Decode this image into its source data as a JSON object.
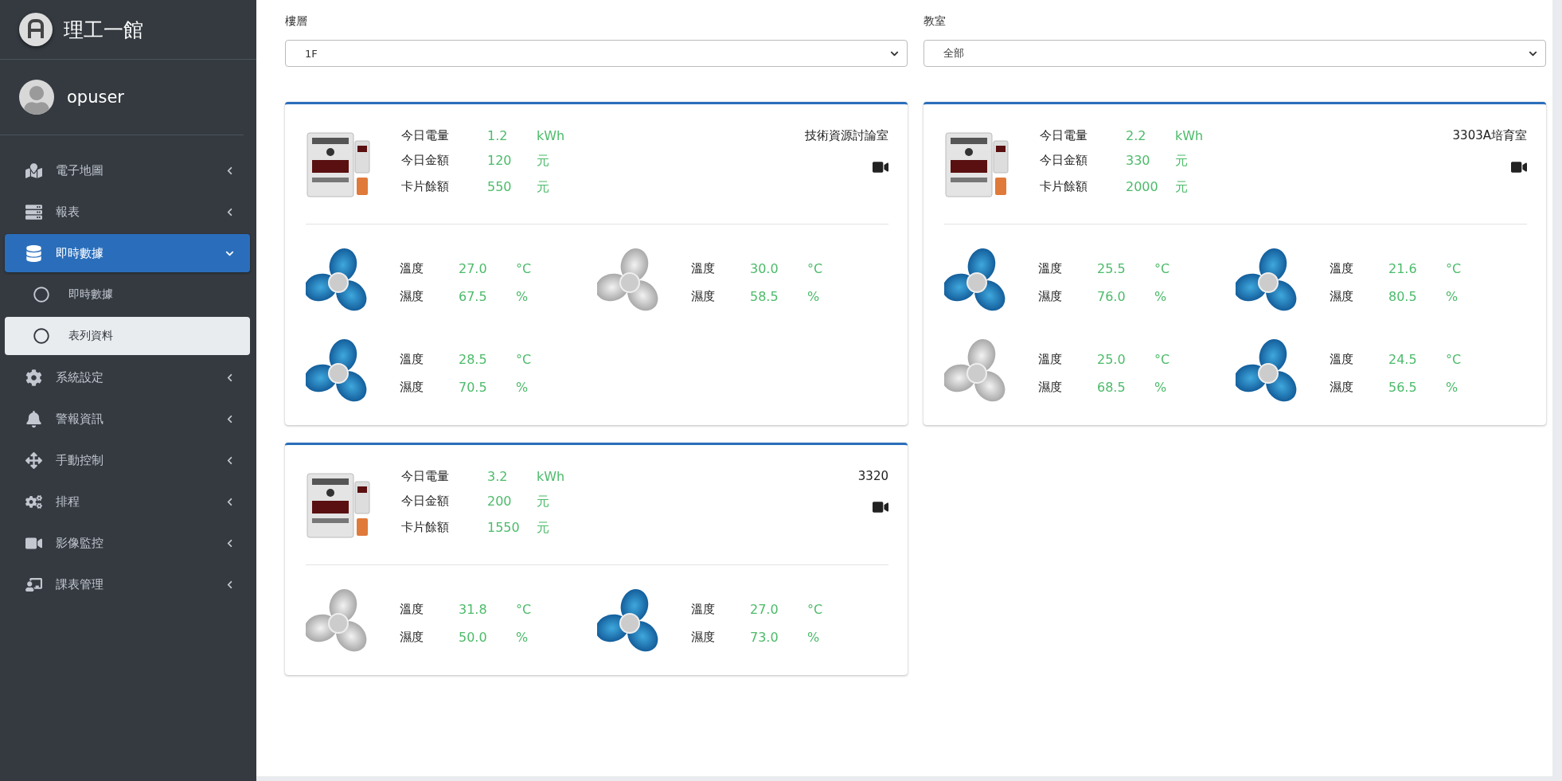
{
  "sidebar": {
    "brand": "理工一館",
    "user": "opuser",
    "menu": [
      {
        "label": "電子地圖",
        "selected": false,
        "expanded": false
      },
      {
        "label": "報表",
        "selected": false,
        "expanded": false
      },
      {
        "label": "即時數據",
        "selected": true,
        "expanded": true,
        "children": [
          {
            "label": "即時數據",
            "selected": false
          },
          {
            "label": "表列資料",
            "selected": true
          }
        ]
      },
      {
        "label": "系統設定",
        "selected": false,
        "expanded": false
      },
      {
        "label": "警報資訊",
        "selected": false,
        "expanded": false
      },
      {
        "label": "手動控制",
        "selected": false,
        "expanded": false
      },
      {
        "label": "排程",
        "selected": false,
        "expanded": false
      },
      {
        "label": "影像監控",
        "selected": false,
        "expanded": false
      },
      {
        "label": "課表管理",
        "selected": false,
        "expanded": false
      }
    ]
  },
  "filters": [
    {
      "label": "樓層",
      "value": "1F"
    },
    {
      "label": "教室",
      "value": "全部"
    }
  ],
  "cards": [
    {
      "room": "技術資源討論室",
      "meter": [
        {
          "label": "今日電量",
          "value": "1.2",
          "unit": "kWh"
        },
        {
          "label": "今日金額",
          "value": "120",
          "unit": "元"
        },
        {
          "label": "卡片餘額",
          "value": "550",
          "unit": "元"
        }
      ],
      "sensors": [
        {
          "on": true,
          "readings": [
            {
              "label": "溫度",
              "value": "27.0",
              "unit": "°C"
            },
            {
              "label": "濕度",
              "value": "67.5",
              "unit": "%"
            }
          ]
        },
        {
          "on": false,
          "readings": [
            {
              "label": "溫度",
              "value": "30.0",
              "unit": "°C"
            },
            {
              "label": "濕度",
              "value": "58.5",
              "unit": "%"
            }
          ]
        },
        {
          "on": true,
          "readings": [
            {
              "label": "溫度",
              "value": "28.5",
              "unit": "°C"
            },
            {
              "label": "濕度",
              "value": "70.5",
              "unit": "%"
            }
          ]
        }
      ]
    },
    {
      "room": "3303A培育室",
      "meter": [
        {
          "label": "今日電量",
          "value": "2.2",
          "unit": "kWh"
        },
        {
          "label": "今日金額",
          "value": "330",
          "unit": "元"
        },
        {
          "label": "卡片餘額",
          "value": "2000",
          "unit": "元"
        }
      ],
      "sensors": [
        {
          "on": true,
          "readings": [
            {
              "label": "溫度",
              "value": "25.5",
              "unit": "°C"
            },
            {
              "label": "濕度",
              "value": "76.0",
              "unit": "%"
            }
          ]
        },
        {
          "on": true,
          "readings": [
            {
              "label": "溫度",
              "value": "21.6",
              "unit": "°C"
            },
            {
              "label": "濕度",
              "value": "80.5",
              "unit": "%"
            }
          ]
        },
        {
          "on": false,
          "readings": [
            {
              "label": "溫度",
              "value": "25.0",
              "unit": "°C"
            },
            {
              "label": "濕度",
              "value": "68.5",
              "unit": "%"
            }
          ]
        },
        {
          "on": true,
          "readings": [
            {
              "label": "溫度",
              "value": "24.5",
              "unit": "°C"
            },
            {
              "label": "濕度",
              "value": "56.5",
              "unit": "%"
            }
          ]
        }
      ]
    },
    {
      "room": "3320",
      "meter": [
        {
          "label": "今日電量",
          "value": "3.2",
          "unit": "kWh"
        },
        {
          "label": "今日金額",
          "value": "200",
          "unit": "元"
        },
        {
          "label": "卡片餘額",
          "value": "1550",
          "unit": "元"
        }
      ],
      "sensors": [
        {
          "on": false,
          "readings": [
            {
              "label": "溫度",
              "value": "31.8",
              "unit": "°C"
            },
            {
              "label": "濕度",
              "value": "50.0",
              "unit": "%"
            }
          ]
        },
        {
          "on": true,
          "readings": [
            {
              "label": "溫度",
              "value": "27.0",
              "unit": "°C"
            },
            {
              "label": "濕度",
              "value": "73.0",
              "unit": "%"
            }
          ]
        }
      ]
    }
  ]
}
